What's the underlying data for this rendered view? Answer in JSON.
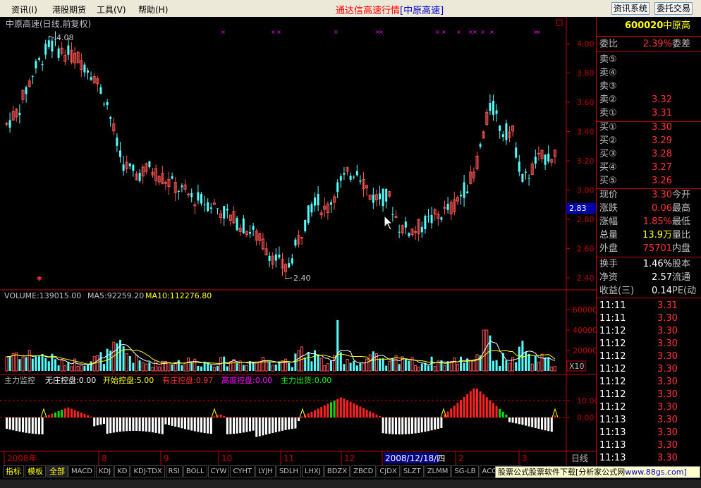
{
  "menu": {
    "items": [
      "资讯(I)",
      "港股期货",
      "工具(V)",
      "帮助(H)"
    ],
    "title": "通达信高速行情",
    "title_code": "[中原高速]",
    "btn_info": "资讯系统",
    "btn_trade": "委托交易"
  },
  "chart": {
    "title": "中原高速(日线,前复权)",
    "price_axis": [
      "4.00",
      "3.80",
      "3.60",
      "3.40",
      "3.20",
      "3.00",
      "2.80",
      "2.60",
      "2.40"
    ],
    "current_price_tag": "2.83",
    "high_label": "4.08",
    "low_label": "2.40",
    "volume_label": "VOLUME:139015.00",
    "ma5_label": "MA5:92259.20",
    "ma10_label": "MA10:112276.80",
    "volume_axis": [
      "60000",
      "40000",
      "20000"
    ],
    "volume_unit": "X10",
    "ind_name": "主力监控",
    "ind_label_1": "无庄控盘:0.00",
    "ind_label_2": "开始控盘:5.00",
    "ind_label_3": "有庄控盘:0.97",
    "ind_label_4": "高度控盘:0.00",
    "ind_label_5": "主力出货:0.00",
    "ind_axis": [
      "10.00",
      "0.00"
    ],
    "dates": [
      "2008年",
      "8",
      "9",
      "10",
      "11",
      "12",
      "2008/12/18/四",
      "2",
      "3"
    ],
    "period": "日线"
  },
  "quote": {
    "code": "600020",
    "name": "中原高",
    "weibi_label": "委比",
    "weibi": "2.39%",
    "weicha_label": "委差",
    "sell": [
      {
        "label": "卖⑤",
        "price": ""
      },
      {
        "label": "卖④",
        "price": ""
      },
      {
        "label": "卖③",
        "price": ""
      },
      {
        "label": "卖②",
        "price": "3.32"
      },
      {
        "label": "卖①",
        "price": "3.31"
      }
    ],
    "buy": [
      {
        "label": "买①",
        "price": "3.30"
      },
      {
        "label": "买②",
        "price": "3.29"
      },
      {
        "label": "买③",
        "price": "3.28"
      },
      {
        "label": "买④",
        "price": "3.27"
      },
      {
        "label": "买⑤",
        "price": "3.26"
      }
    ],
    "stats": [
      {
        "label": "现价",
        "value": "3.30",
        "label2": "今开"
      },
      {
        "label": "涨跌",
        "value": "0.06",
        "label2": "最高"
      },
      {
        "label": "涨幅",
        "value": "1.85%",
        "label2": "最低"
      },
      {
        "label": "总量",
        "value": "13.9万",
        "label2": "量比"
      },
      {
        "label": "外盘",
        "value": "75701",
        "label2": "内盘"
      }
    ],
    "stats2": [
      {
        "label": "换手",
        "value": "1.46%",
        "label2": "股本"
      },
      {
        "label": "净资",
        "value": "2.57",
        "label2": "流通"
      },
      {
        "label": "收益(三)",
        "value": "0.14",
        "label2": "PE(动"
      }
    ],
    "ticks": [
      {
        "t": "11:11",
        "p": "3.31"
      },
      {
        "t": "11:11",
        "p": "3.30"
      },
      {
        "t": "11:12",
        "p": "3.30"
      },
      {
        "t": "11:12",
        "p": "3.30"
      },
      {
        "t": "11:12",
        "p": "3.30"
      },
      {
        "t": "11:12",
        "p": "3.30"
      },
      {
        "t": "11:12",
        "p": "3.30"
      },
      {
        "t": "11:12",
        "p": "3.30"
      },
      {
        "t": "11:12",
        "p": "3.30"
      },
      {
        "t": "11:13",
        "p": "3.30"
      },
      {
        "t": "11:13",
        "p": "3.30"
      },
      {
        "t": "11:13",
        "p": "3.30"
      },
      {
        "t": "11:13",
        "p": "3.30"
      }
    ]
  },
  "tabs": [
    "指标",
    "模板",
    "全部",
    "MACD",
    "KDJ",
    "KD",
    "KDJ-TDX",
    "RSI",
    "BOLL",
    "CYW",
    "CYHT",
    "LYJH",
    "SDLH",
    "LHXJ",
    "BDZX",
    "ZBCD",
    "CJDX",
    "SLZT",
    "ZLMM",
    "SG-LB",
    "ACCER",
    "JS"
  ],
  "ad": {
    "text": "股票公式股票软件下载[分析家公式网",
    "url": "www.88gs.com]"
  }
}
